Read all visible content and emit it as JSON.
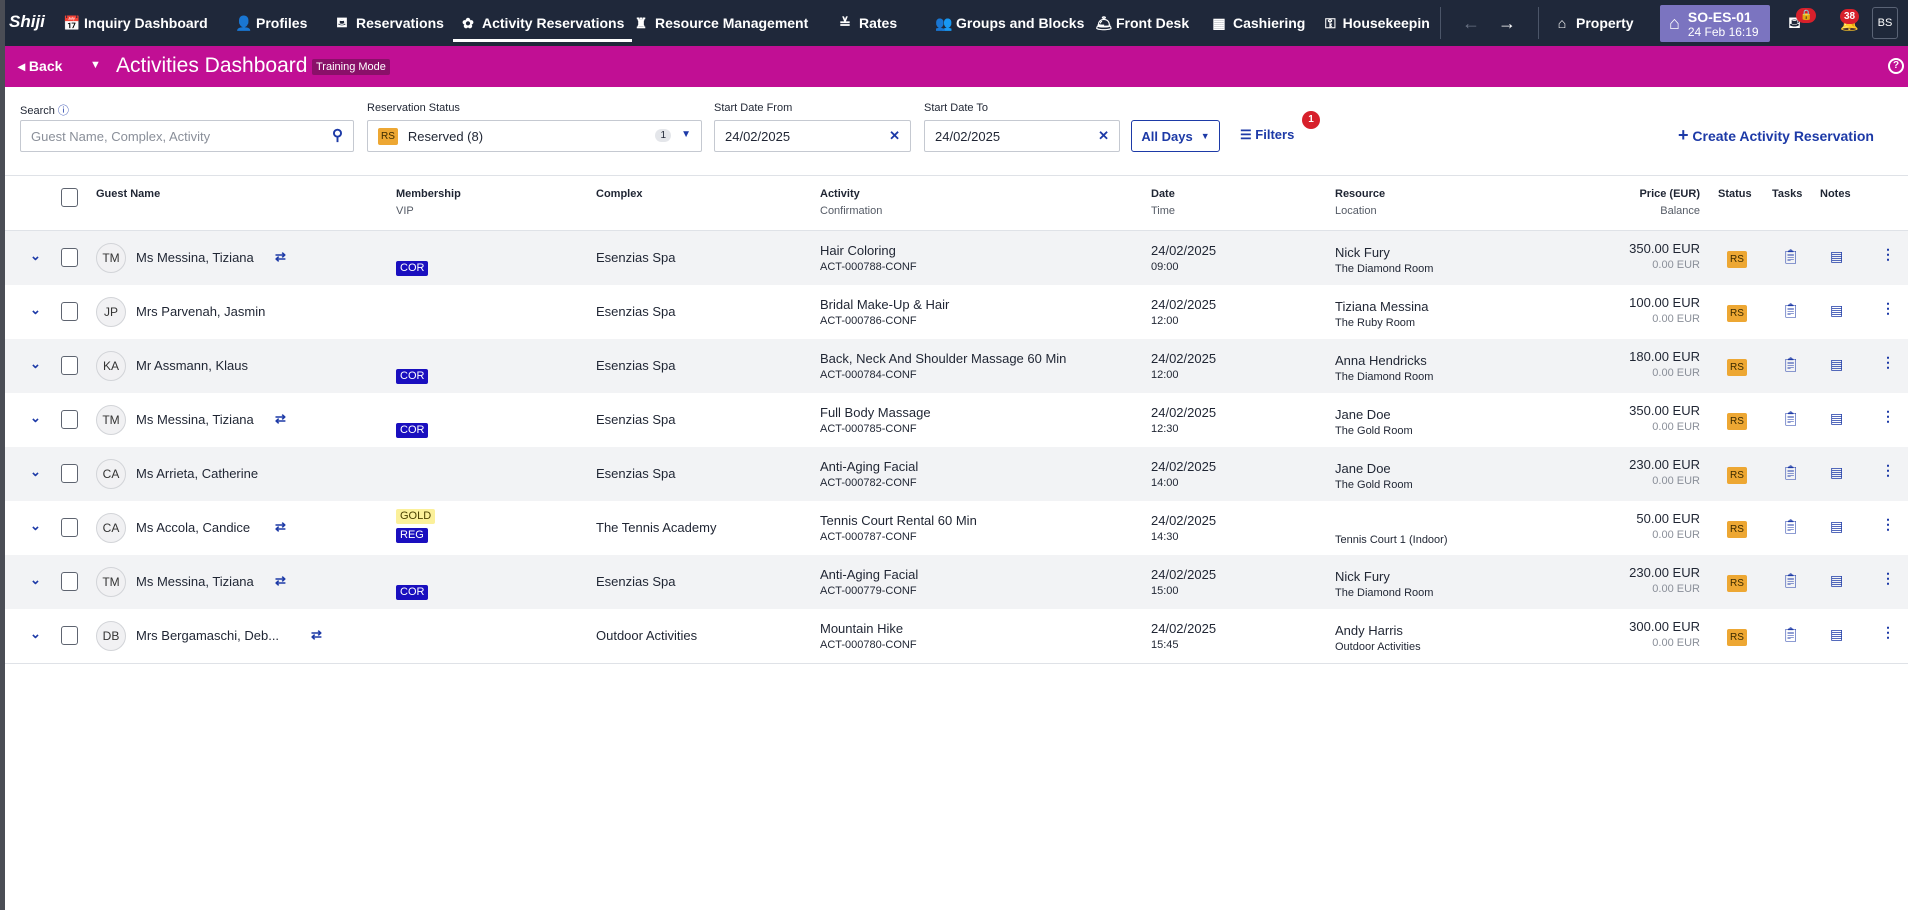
{
  "nav": {
    "logo": "Shiji",
    "items": [
      {
        "label": "Inquiry Dashboard",
        "icon": "📅"
      },
      {
        "label": "Profiles",
        "icon": "👤"
      },
      {
        "label": "Reservations",
        "icon": "⛾"
      },
      {
        "label": "Activity Reservations",
        "icon": "✿"
      },
      {
        "label": "Resource Management",
        "icon": "♜"
      },
      {
        "label": "Rates",
        "icon": "≚"
      },
      {
        "label": "Groups and Blocks",
        "icon": "👥"
      },
      {
        "label": "Front Desk",
        "icon": "🛎"
      },
      {
        "label": "Cashiering",
        "icon": "▦"
      },
      {
        "label": "Housekeeping",
        "icon": "⚿"
      }
    ],
    "property_label": "Property",
    "property_code": "SO-ES-01",
    "property_datetime": "24 Feb 16:19",
    "lock_badge": "🔒",
    "notifications_count": "38",
    "user_initials": "BS"
  },
  "header": {
    "back_label": "Back",
    "title": "Activities Dashboard",
    "mode_badge": "Training Mode"
  },
  "filters": {
    "search_label": "Search",
    "search_placeholder": "Guest Name, Complex, Activity",
    "status_label": "Reservation Status",
    "status_code": "RS",
    "status_value": "Reserved (8)",
    "status_count": "1",
    "from_label": "Start Date From",
    "from_value": "24/02/2025",
    "to_label": "Start Date To",
    "to_value": "24/02/2025",
    "days_value": "All Days",
    "filters_label": "Filters",
    "filters_count": "1",
    "create_label": "Create Activity Reservation"
  },
  "columns": {
    "guest": "Guest Name",
    "membership": "Membership",
    "vip": "VIP",
    "complex": "Complex",
    "activity": "Activity",
    "confirmation": "Confirmation",
    "date": "Date",
    "time": "Time",
    "resource": "Resource",
    "location": "Location",
    "price": "Price (EUR)",
    "balance": "Balance",
    "status": "Status",
    "tasks": "Tasks",
    "notes": "Notes"
  },
  "rows": [
    {
      "initials": "TM",
      "name": "Ms Messina, Tiziana",
      "linked": true,
      "tags": [
        {
          "t": "COR",
          "c": "blue"
        }
      ],
      "complex": "Esenzias Spa",
      "activity": "Hair Coloring",
      "conf": "ACT-000788-CONF",
      "date": "24/02/2025",
      "time": "09:00",
      "resource": "Nick Fury",
      "location": "The Diamond Room",
      "price": "350.00 EUR",
      "balance": "0.00 EUR",
      "status": "RS"
    },
    {
      "initials": "JP",
      "name": "Mrs Parvenah, Jasmin",
      "linked": false,
      "tags": [],
      "complex": "Esenzias Spa",
      "activity": "Bridal Make-Up & Hair",
      "conf": "ACT-000786-CONF",
      "date": "24/02/2025",
      "time": "12:00",
      "resource": "Tiziana Messina",
      "location": "The Ruby Room",
      "price": "100.00 EUR",
      "balance": "0.00 EUR",
      "status": "RS"
    },
    {
      "initials": "KA",
      "name": "Mr Assmann, Klaus",
      "linked": false,
      "tags": [
        {
          "t": "COR",
          "c": "blue"
        }
      ],
      "complex": "Esenzias Spa",
      "activity": "Back, Neck And Shoulder Massage 60 Min",
      "conf": "ACT-000784-CONF",
      "date": "24/02/2025",
      "time": "12:00",
      "resource": "Anna Hendricks",
      "location": "The Diamond Room",
      "price": "180.00 EUR",
      "balance": "0.00 EUR",
      "status": "RS"
    },
    {
      "initials": "TM",
      "name": "Ms Messina, Tiziana",
      "linked": true,
      "tags": [
        {
          "t": "COR",
          "c": "blue"
        }
      ],
      "complex": "Esenzias Spa",
      "activity": "Full Body Massage",
      "conf": "ACT-000785-CONF",
      "date": "24/02/2025",
      "time": "12:30",
      "resource": "Jane Doe",
      "location": "The Gold Room",
      "price": "350.00 EUR",
      "balance": "0.00 EUR",
      "status": "RS"
    },
    {
      "initials": "CA",
      "name": "Ms Arrieta, Catherine",
      "linked": false,
      "tags": [],
      "complex": "Esenzias Spa",
      "activity": "Anti-Aging Facial",
      "conf": "ACT-000782-CONF",
      "date": "24/02/2025",
      "time": "14:00",
      "resource": "Jane Doe",
      "location": "The Gold Room",
      "price": "230.00 EUR",
      "balance": "0.00 EUR",
      "status": "RS"
    },
    {
      "initials": "CA",
      "name": "Ms Accola, Candice",
      "linked": true,
      "tags": [
        {
          "t": "GOLD",
          "c": "gold"
        },
        {
          "t": "REG",
          "c": "blue"
        }
      ],
      "complex": "The Tennis Academy",
      "activity": "Tennis Court Rental 60 Min",
      "conf": "ACT-000787-CONF",
      "date": "24/02/2025",
      "time": "14:30",
      "resource": "",
      "location": "Tennis Court 1 (Indoor)",
      "price": "50.00 EUR",
      "balance": "0.00 EUR",
      "status": "RS"
    },
    {
      "initials": "TM",
      "name": "Ms Messina, Tiziana",
      "linked": true,
      "tags": [
        {
          "t": "COR",
          "c": "blue"
        }
      ],
      "complex": "Esenzias Spa",
      "activity": "Anti-Aging Facial",
      "conf": "ACT-000779-CONF",
      "date": "24/02/2025",
      "time": "15:00",
      "resource": "Nick Fury",
      "location": "The Diamond Room",
      "price": "230.00 EUR",
      "balance": "0.00 EUR",
      "status": "RS"
    },
    {
      "initials": "DB",
      "name": "Mrs Bergamaschi, Deb...",
      "linked": true,
      "tags": [],
      "complex": "Outdoor Activities",
      "activity": "Mountain Hike",
      "conf": "ACT-000780-CONF",
      "date": "24/02/2025",
      "time": "15:45",
      "resource": "Andy Harris",
      "location": "Outdoor Activities",
      "price": "300.00 EUR",
      "balance": "0.00 EUR",
      "status": "RS"
    }
  ],
  "colors": {
    "nav": "#1f283a",
    "header": "#c10f94",
    "accent": "#1d3aa7",
    "status_rs": "#eda733"
  }
}
